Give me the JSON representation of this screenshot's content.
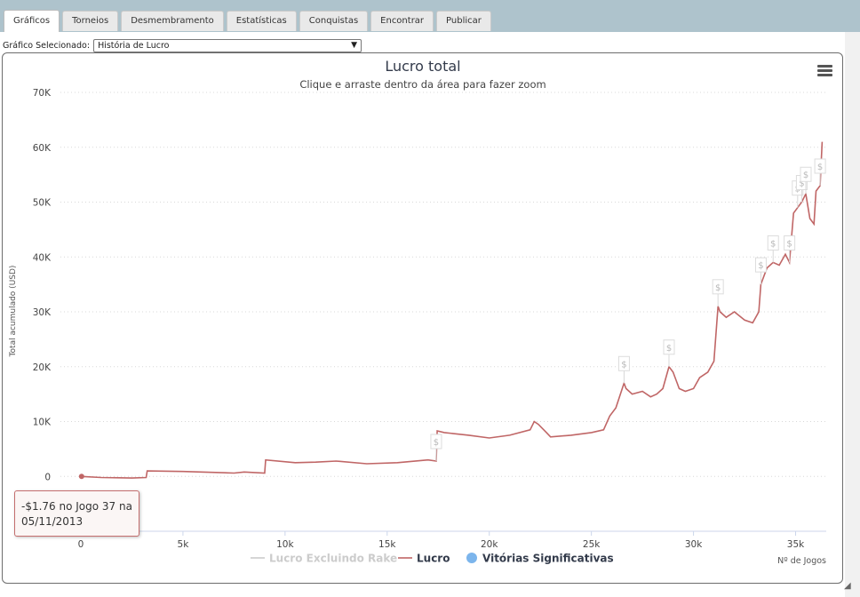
{
  "tabs": [
    {
      "label": "Gráficos",
      "active": true
    },
    {
      "label": "Torneios",
      "active": false
    },
    {
      "label": "Desmembramento",
      "active": false
    },
    {
      "label": "Estatísticas",
      "active": false
    },
    {
      "label": "Conquistas",
      "active": false
    },
    {
      "label": "Encontrar",
      "active": false
    },
    {
      "label": "Publicar",
      "active": false
    }
  ],
  "selector": {
    "label": "Gráfico Selecionado:",
    "value": "História de Lucro"
  },
  "menu_icon": "hamburger-menu-icon",
  "tooltip": {
    "line1": "-$1.76 no Jogo 37 na",
    "line2": "05/11/2013"
  },
  "chart_data": {
    "type": "line",
    "title": "Lucro total",
    "subtitle": "Clique e arraste dentro da área para fazer zoom",
    "xlabel": "Nº de Jogos",
    "ylabel": "Total acumulado (USD)",
    "xlim": [
      -1000,
      36500
    ],
    "ylim": [
      -10000,
      70000
    ],
    "x_ticks": [
      0,
      5000,
      10000,
      15000,
      20000,
      25000,
      30000,
      35000
    ],
    "x_tick_labels": [
      "0",
      "5k",
      "10k",
      "15k",
      "20k",
      "25k",
      "30k",
      "35k"
    ],
    "y_ticks": [
      0,
      10000,
      20000,
      30000,
      40000,
      50000,
      60000,
      70000
    ],
    "y_tick_labels": [
      "0",
      "10K",
      "20K",
      "30K",
      "40K",
      "50K",
      "60K",
      "70K"
    ],
    "grid": true,
    "legend": {
      "placement": "bottom",
      "items": [
        {
          "name": "Lucro Excluindo Rake",
          "color": "#cccccc",
          "visible": false
        },
        {
          "name": "Lucro",
          "color": "#c06666",
          "visible": true
        },
        {
          "name": "Vitórias Significativas",
          "color": "#7cb5ec",
          "visible": true
        }
      ]
    },
    "series": [
      {
        "name": "Lucro",
        "color": "#c06666",
        "x": [
          37,
          1000,
          2500,
          3200,
          3250,
          5000,
          7500,
          8000,
          9000,
          9050,
          10500,
          11500,
          12500,
          14000,
          15500,
          17000,
          17400,
          17450,
          17800,
          19000,
          20000,
          21000,
          22000,
          22200,
          22400,
          22800,
          23000,
          24000,
          25000,
          25600,
          25900,
          26200,
          26600,
          26700,
          27000,
          27500,
          27900,
          28200,
          28500,
          28800,
          29000,
          29300,
          29600,
          30000,
          30300,
          30700,
          31000,
          31200,
          31300,
          31600,
          32000,
          32500,
          32900,
          33200,
          33300,
          33600,
          33900,
          34200,
          34500,
          34700,
          34900,
          35100,
          35300,
          35500,
          35700,
          35900,
          36000,
          36200,
          36300
        ],
        "y": [
          0,
          -200,
          -300,
          -200,
          1000,
          900,
          600,
          800,
          600,
          3000,
          2500,
          2600,
          2800,
          2300,
          2500,
          3000,
          2800,
          8300,
          8000,
          7500,
          7000,
          7500,
          8500,
          10000,
          9500,
          8000,
          7200,
          7500,
          8000,
          8500,
          11000,
          12500,
          17000,
          16000,
          15000,
          15500,
          14500,
          15000,
          16000,
          20000,
          19000,
          16000,
          15500,
          16000,
          18000,
          19000,
          21000,
          31000,
          30000,
          29000,
          30000,
          28500,
          28000,
          30000,
          35000,
          38000,
          39000,
          38500,
          40500,
          39000,
          48000,
          49000,
          50000,
          51500,
          47000,
          46000,
          52000,
          53000,
          61000
        ]
      }
    ],
    "significant_wins": [
      17400,
      26600,
      28800,
      31200,
      33300,
      33900,
      34700,
      35100,
      35300,
      35500,
      36200
    ]
  }
}
